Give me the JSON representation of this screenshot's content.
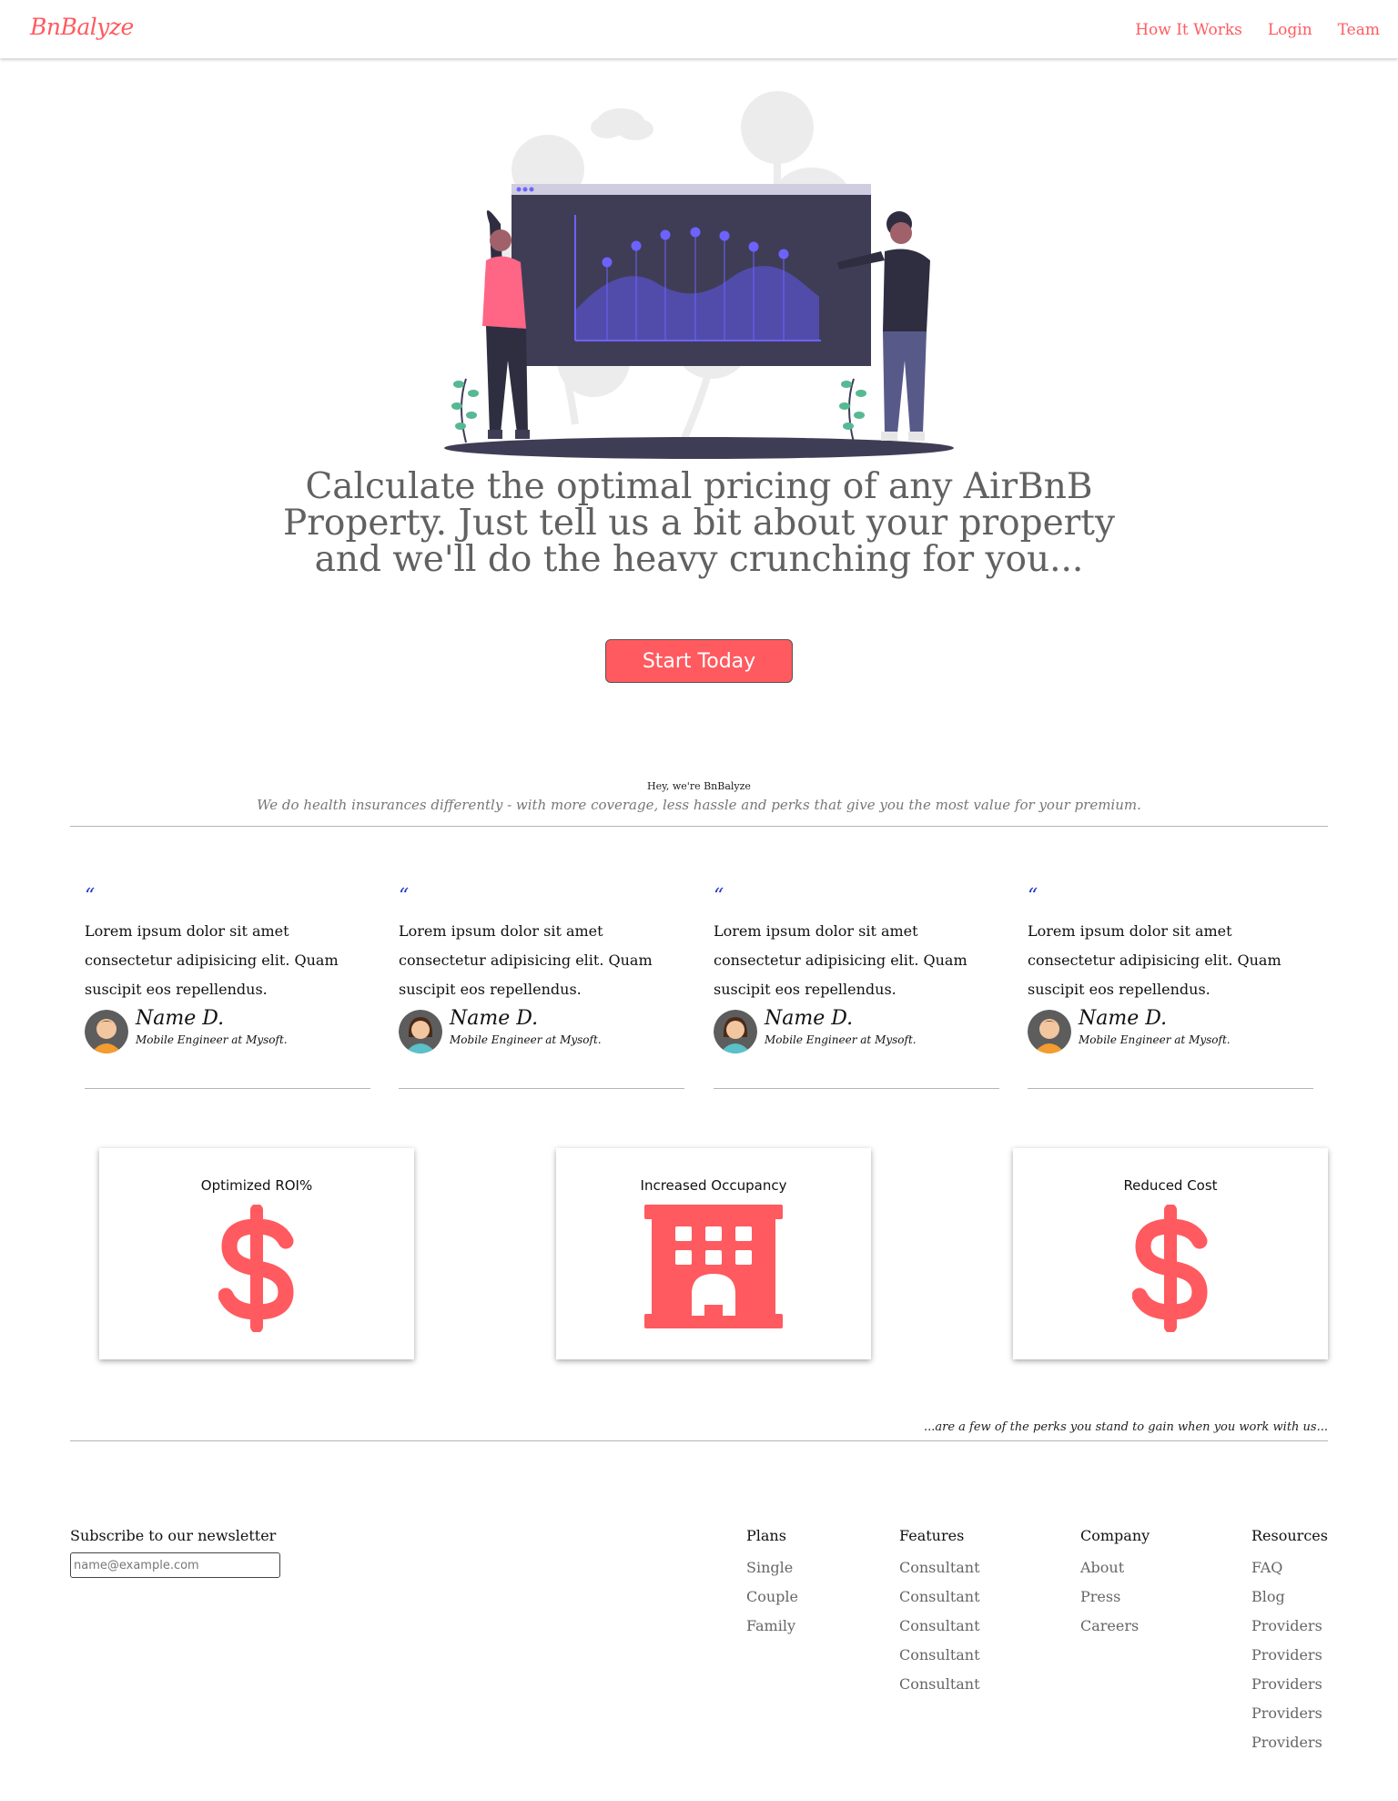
{
  "nav": {
    "logo": "BnBalyze",
    "links": [
      "How It Works",
      "Login",
      "Team"
    ]
  },
  "hero": {
    "title": "Calculate the optimal pricing of any AirBnB Property. Just tell us a bit about your property and we'll do the heavy crunching for you...",
    "cta": "Start Today"
  },
  "about": {
    "intro": "Hey, we're BnBalyze",
    "tagline": "We do health insurances differently - with more coverage, less hassle and perks that give you the most value for your premium."
  },
  "testimonials": [
    {
      "quote_mark": "“",
      "text": "Lorem ipsum dolor sit amet consectetur adipisicing elit. Quam suscipit eos repellendus.",
      "name": "Name D.",
      "role": "Mobile Engineer at Mysoft.",
      "avatar": "male-avatar"
    },
    {
      "quote_mark": "“",
      "text": "Lorem ipsum dolor sit amet consectetur adipisicing elit. Quam suscipit eos repellendus.",
      "name": "Name D.",
      "role": "Mobile Engineer at Mysoft.",
      "avatar": "female-avatar"
    },
    {
      "quote_mark": "“",
      "text": "Lorem ipsum dolor sit amet consectetur adipisicing elit. Quam suscipit eos repellendus.",
      "name": "Name D.",
      "role": "Mobile Engineer at Mysoft.",
      "avatar": "female-avatar"
    },
    {
      "quote_mark": "“",
      "text": "Lorem ipsum dolor sit amet consectetur adipisicing elit. Quam suscipit eos repellendus.",
      "name": "Name D.",
      "role": "Mobile Engineer at Mysoft.",
      "avatar": "male-avatar"
    }
  ],
  "features": [
    {
      "title": "Optimized ROI%",
      "icon": "dollar-icon"
    },
    {
      "title": "Increased Occupancy",
      "icon": "building-icon"
    },
    {
      "title": "Reduced Cost",
      "icon": "dollar-icon"
    }
  ],
  "perks_text": "...are a few of the perks you stand to gain when you work with us...",
  "footer": {
    "newsletter_label": "Subscribe to our newsletter",
    "newsletter_placeholder": "name@example.com",
    "columns": [
      {
        "heading": "Plans",
        "links": [
          "Single",
          "Couple",
          "Family"
        ]
      },
      {
        "heading": "Features",
        "links": [
          "Consultant",
          "Consultant",
          "Consultant",
          "Consultant",
          "Consultant"
        ]
      },
      {
        "heading": "Company",
        "links": [
          "About",
          "Press",
          "Careers"
        ]
      },
      {
        "heading": "Resources",
        "links": [
          "FAQ",
          "Blog",
          "Providers",
          "Providers",
          "Providers",
          "Providers",
          "Providers"
        ]
      }
    ]
  },
  "colors": {
    "brand": "#ff5a5f",
    "quote": "#2a39c9",
    "illustration_dark": "#3f3d56",
    "illustration_accent": "#6c63ff"
  }
}
